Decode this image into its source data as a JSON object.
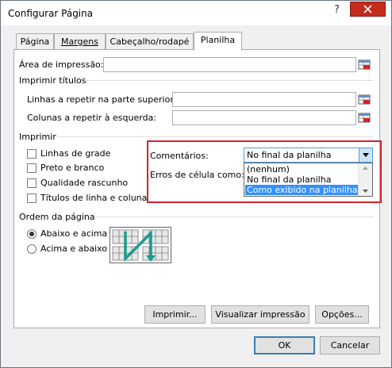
{
  "window": {
    "title": "Configurar Página"
  },
  "tabs": [
    {
      "label": "Página"
    },
    {
      "label": "Margens"
    },
    {
      "label": "Cabeçalho/rodapé"
    },
    {
      "label": "Planilha",
      "active": true
    }
  ],
  "print_area": {
    "label": "Área de impressão:",
    "value": ""
  },
  "print_titles": {
    "heading": "Imprimir títulos",
    "rows_label": "Linhas a repetir na parte superior:",
    "rows_value": "",
    "cols_label": "Colunas a repetir à esquerda:",
    "cols_value": ""
  },
  "print": {
    "heading": "Imprimir",
    "checkboxes": [
      {
        "label": "Linhas de grade",
        "checked": false
      },
      {
        "label": "Preto e branco",
        "checked": false
      },
      {
        "label": "Qualidade rascunho",
        "checked": false
      },
      {
        "label": "Títulos de linha e coluna",
        "checked": false
      }
    ],
    "comments_label": "Comentários:",
    "comments_value": "No final da planilha",
    "errors_label": "Erros de célula como:",
    "comments_options": [
      "(nenhum)",
      "No final da planilha",
      "Como exibido na planilha"
    ],
    "highlighted_option": "Como exibido na planilha"
  },
  "page_order": {
    "heading": "Ordem da página",
    "options": [
      {
        "label": "Abaixo e acima",
        "selected": true
      },
      {
        "label": "Acima e abaixo",
        "selected": false
      }
    ]
  },
  "buttons": {
    "print": "Imprimir...",
    "preview": "Visualizar impressão",
    "options": "Opções...",
    "ok": "OK",
    "cancel": "Cancelar"
  },
  "colors": {
    "highlight_border": "#d2232a",
    "selection": "#3390ff",
    "close_button": "#c42b1c"
  }
}
